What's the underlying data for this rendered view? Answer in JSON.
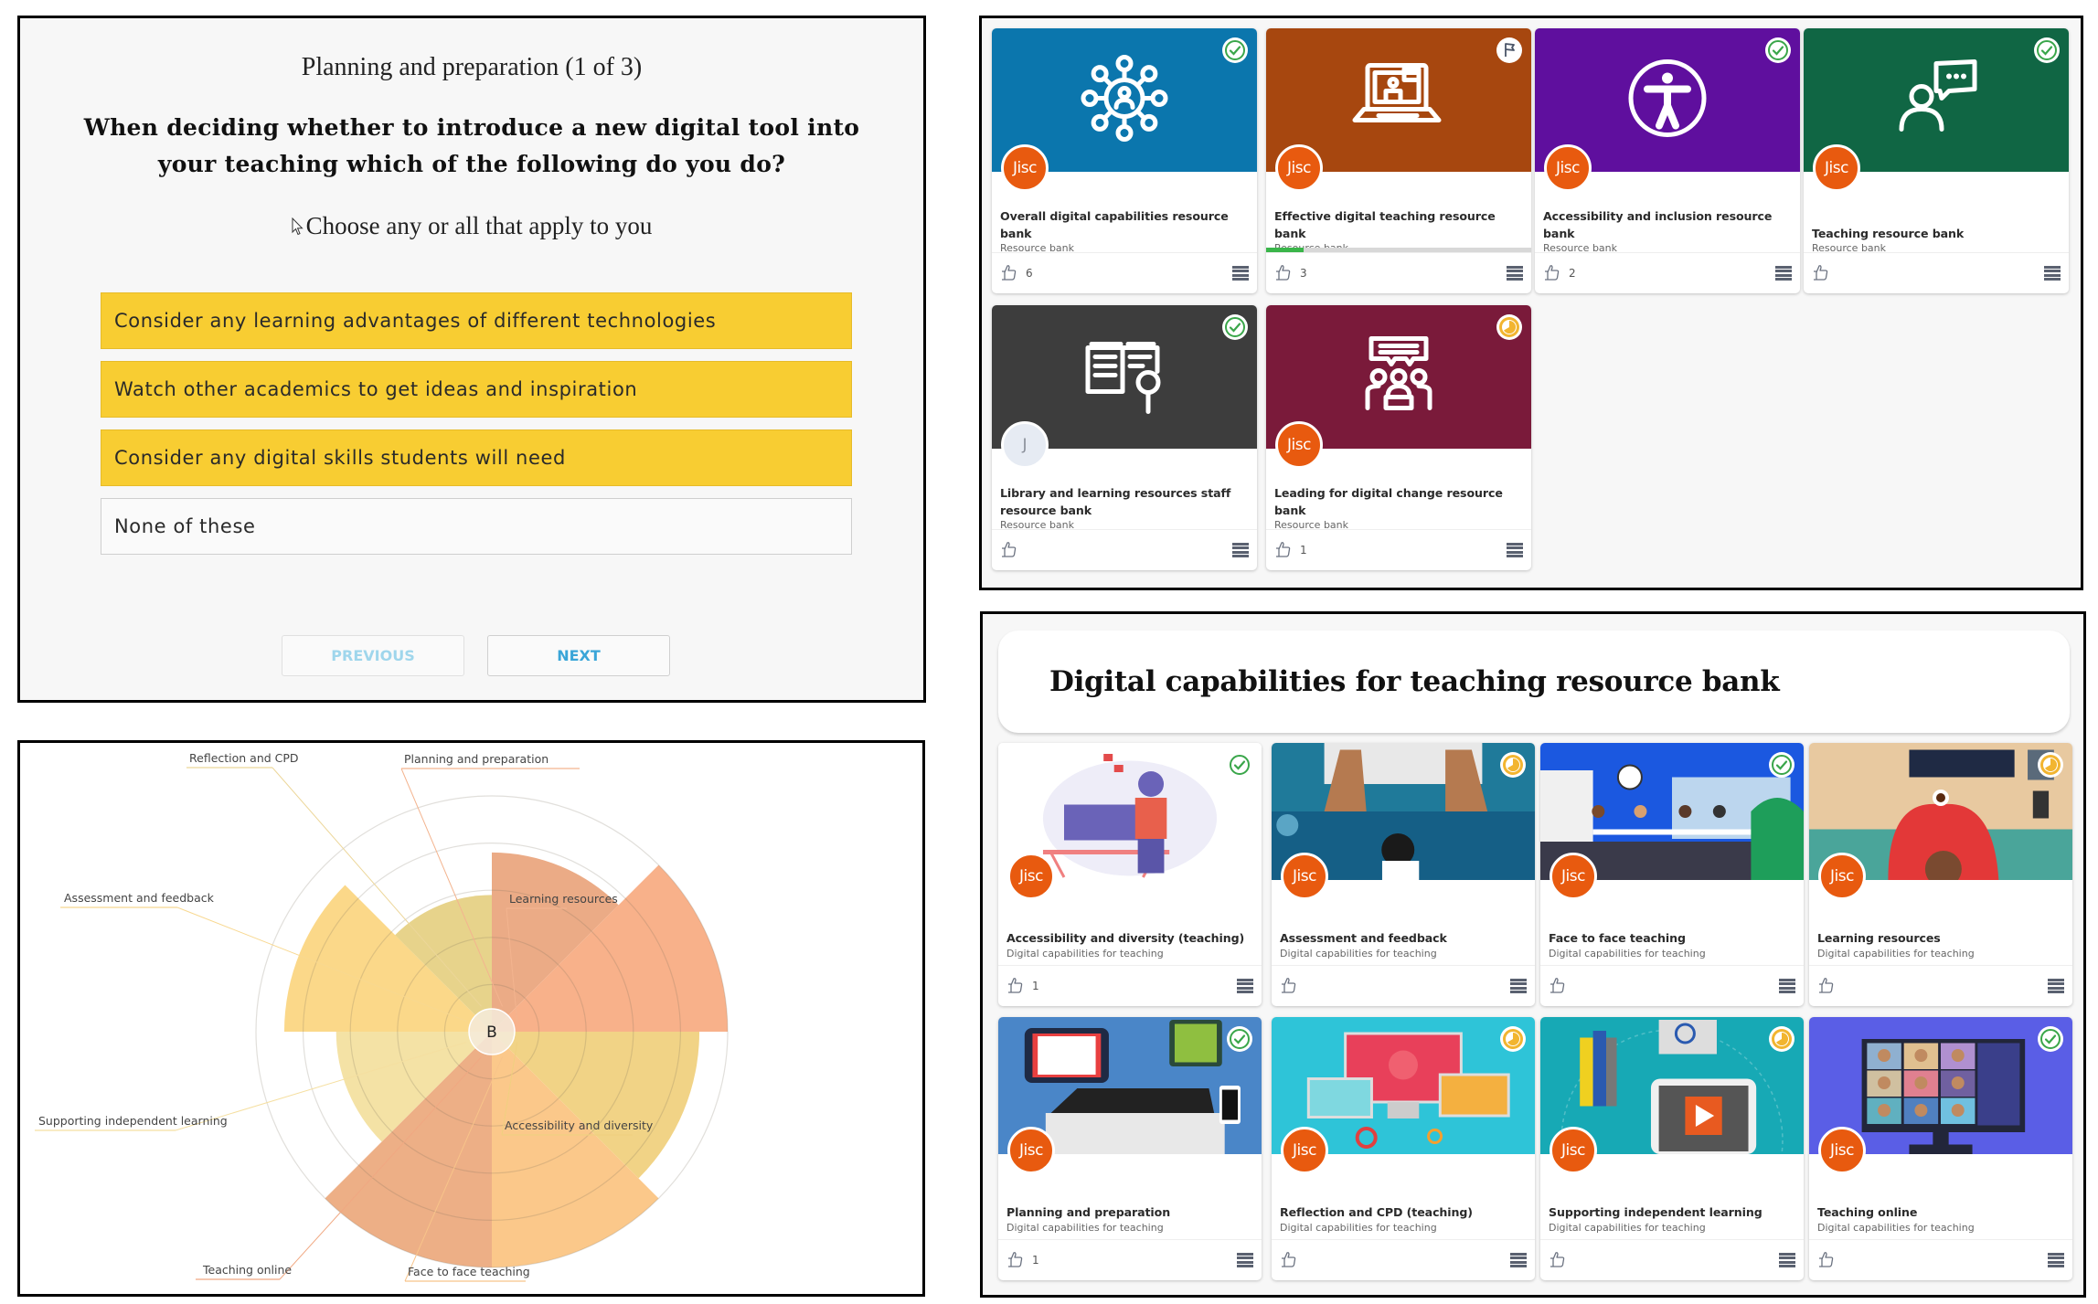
{
  "quiz": {
    "section": "Planning and preparation (1 of 3)",
    "question": "When deciding whether to introduce a new digital tool into your teaching which of the following do you do?",
    "hint": "Choose any or all that apply to you",
    "options": [
      {
        "label": "Consider any learning advantages of different technologies",
        "selected": true
      },
      {
        "label": "Watch other academics to get ideas and inspiration",
        "selected": true
      },
      {
        "label": "Consider any digital skills students will need",
        "selected": true
      },
      {
        "label": "None of these",
        "selected": false
      }
    ],
    "previous_label": "PREVIOUS",
    "next_label": "NEXT",
    "colors": {
      "selected": "#f8cd32",
      "previous_text": "#9fd6ec",
      "next_text": "#3aa5d8"
    }
  },
  "chart_data": {
    "type": "polar-area",
    "title": "",
    "center_label": "B",
    "scale_max": 5,
    "rings": [
      1,
      2,
      3,
      4,
      5
    ],
    "grid": true,
    "categories": [
      "Planning and preparation",
      "Learning resources",
      "Accessibility and diversity",
      "Face to face teaching",
      "Teaching online",
      "Supporting independent learning",
      "Assessment and feedback",
      "Reflection and CPD"
    ],
    "values": [
      3.8,
      5.0,
      4.4,
      5.0,
      5.0,
      3.3,
      4.4,
      2.9
    ],
    "colors": [
      "#eaa77f",
      "#f8ad84",
      "#f0d180",
      "#fbc584",
      "#ecab80",
      "#f3e0a0",
      "#fbd683",
      "#e6d185"
    ],
    "label_line_colors": [
      "#f3b48f",
      "#f3b48f",
      "#f0d080",
      "#f8c48a",
      "#f0a882",
      "#f5dfa0",
      "#f8d890",
      "#ecd699"
    ]
  },
  "resource_banks": {
    "cards": [
      {
        "title": "Overall digital capabilities resource bank",
        "type": "Resource bank",
        "likes": "6",
        "status": "completed",
        "avatar": "Jisc",
        "avatar_kind": "jisc",
        "color": "#0b76ad",
        "icon": "network-people-icon"
      },
      {
        "title": "Effective digital teaching resource bank",
        "type": "Resource bank",
        "likes": "3",
        "status": "flagged",
        "avatar": "Jisc",
        "avatar_kind": "jisc",
        "color": "#a7470f",
        "icon": "laptop-video-icon",
        "progress": 0.14
      },
      {
        "title": "Accessibility and inclusion resource bank",
        "type": "Resource bank",
        "likes": "2",
        "status": "completed",
        "avatar": "Jisc",
        "avatar_kind": "jisc",
        "color": "#5f0f9e",
        "icon": "accessibility-icon"
      },
      {
        "title": "Teaching resource bank",
        "type": "Resource bank",
        "likes": "",
        "status": "completed",
        "avatar": "Jisc",
        "avatar_kind": "jisc",
        "color": "#106644",
        "icon": "speaker-icon"
      },
      {
        "title": "Library and learning resources staff resource bank",
        "type": "Resource bank",
        "likes": "",
        "status": "completed",
        "avatar": "J",
        "avatar_kind": "initial",
        "color": "#3d3d3d",
        "icon": "book-search-icon"
      },
      {
        "title": "Leading for digital change resource bank",
        "type": "Resource bank",
        "likes": "1",
        "status": "in-progress",
        "avatar": "Jisc",
        "avatar_kind": "jisc",
        "color": "#7a1a3a",
        "icon": "group-discussion-icon"
      }
    ]
  },
  "teaching_bank": {
    "title": "Digital capabilities for teaching resource bank",
    "cards": [
      {
        "title": "Accessibility and diversity (teaching)",
        "type": "Digital capabilities for teaching",
        "likes": "1",
        "status": "completed",
        "avatar": "Jisc",
        "illustration": "person-at-desk-illustration",
        "bg": "#ffffff"
      },
      {
        "title": "Assessment and feedback",
        "type": "Digital capabilities for teaching",
        "likes": "",
        "status": "in-progress",
        "avatar": "Jisc",
        "illustration": "hands-keyboard-illustration",
        "bg": "#1f7a9a"
      },
      {
        "title": "Face to face teaching",
        "type": "Digital capabilities for teaching",
        "likes": "",
        "status": "completed",
        "avatar": "Jisc",
        "illustration": "classroom-illustration",
        "bg": "#1b58e0"
      },
      {
        "title": "Learning resources",
        "type": "Digital capabilities for teaching",
        "likes": "",
        "status": "in-progress",
        "avatar": "Jisc",
        "illustration": "desk-topview-illustration",
        "bg": "#e8c9a0"
      },
      {
        "title": "Planning and preparation",
        "type": "Digital capabilities for teaching",
        "likes": "1",
        "status": "completed",
        "avatar": "Jisc",
        "illustration": "devices-illustration",
        "bg": "#4a86c8"
      },
      {
        "title": "Reflection and CPD (teaching)",
        "type": "Digital capabilities for teaching",
        "likes": "",
        "status": "in-progress",
        "avatar": "Jisc",
        "illustration": "network-screens-illustration",
        "bg": "#2ec4d8"
      },
      {
        "title": "Supporting independent learning",
        "type": "Digital capabilities for teaching",
        "likes": "",
        "status": "in-progress",
        "avatar": "Jisc",
        "illustration": "video-tablet-illustration",
        "bg": "#17a9b5"
      },
      {
        "title": "Teaching online",
        "type": "Digital capabilities for teaching",
        "likes": "",
        "status": "completed",
        "avatar": "Jisc",
        "illustration": "video-call-illustration",
        "bg": "#5a5ee6"
      }
    ]
  },
  "status_colors": {
    "completed": "#3aa64a",
    "in-progress": "#f2b530",
    "flagged": "#4a5568"
  },
  "jisc_color": "#e85a0f"
}
